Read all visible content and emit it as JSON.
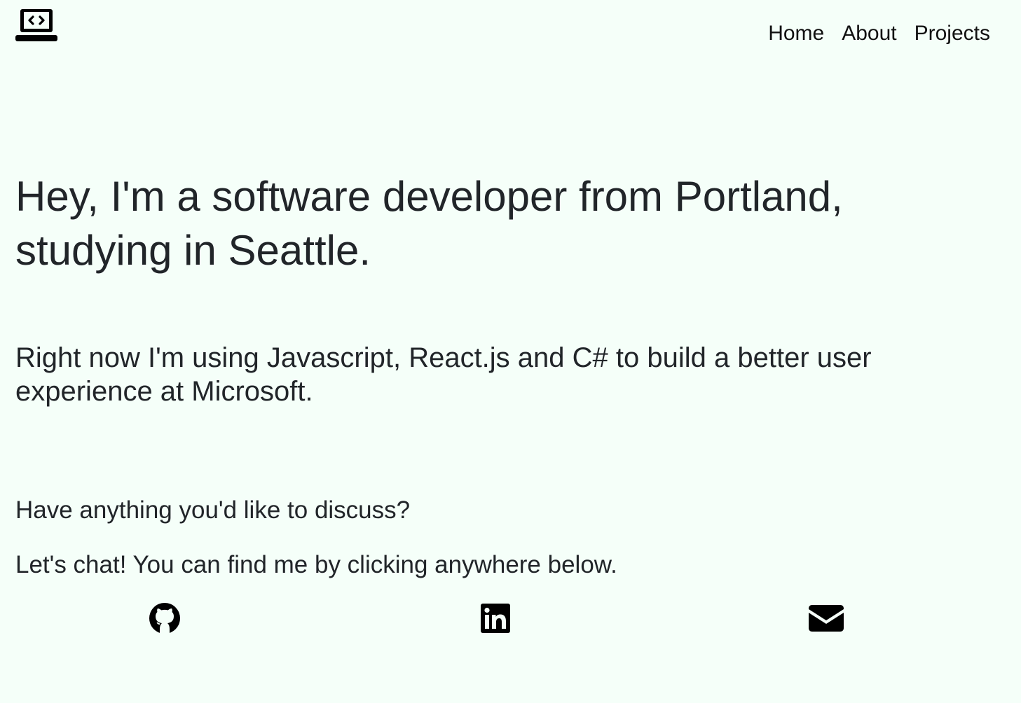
{
  "header": {
    "logo_icon": "laptop-code-icon",
    "nav": [
      {
        "label": "Home"
      },
      {
        "label": "About"
      },
      {
        "label": "Projects"
      }
    ]
  },
  "hero": {
    "headline": "Hey, I'm a software developer from Portland, studying in Seattle.",
    "lead": "Right now I'm using Javascript, React.js and C# to build a better user experience at Microsoft."
  },
  "contact": {
    "question": "Have anything you'd like to discuss?",
    "prompt": "Let's chat! You can find me by clicking anywhere below.",
    "links": [
      {
        "icon": "github-icon"
      },
      {
        "icon": "linkedin-icon"
      },
      {
        "icon": "envelope-icon"
      }
    ]
  },
  "colors": {
    "background": "#f5fff9",
    "text": "#212529",
    "icon": "#000000"
  }
}
